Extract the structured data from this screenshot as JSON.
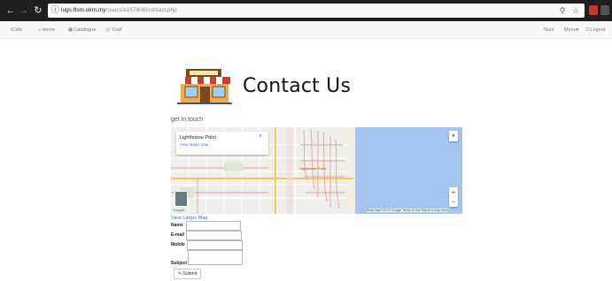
{
  "browser": {
    "url_domain": "lugs.ftsm.ukm.my",
    "url_path": "/users/a157408/contact.php",
    "info_icon": "info-icon",
    "back_icon": "back-arrow-icon",
    "forward_icon": "forward-arrow-icon",
    "reload_icon": "reload-icon"
  },
  "navbar": {
    "brand": "iCafe",
    "items": [
      {
        "label": "Home",
        "icon": "home-icon"
      },
      {
        "label": "Catalogue",
        "icon": "grid-icon"
      },
      {
        "label": "Cart",
        "icon": "cart-icon"
      }
    ],
    "right": [
      {
        "label": "Nuoi"
      },
      {
        "label": "Menu▾"
      },
      {
        "label": "Logout",
        "icon": "logout-icon"
      }
    ]
  },
  "page": {
    "title": "Contact Us",
    "hero_icon": "store-icon",
    "subtitle": "get in touch"
  },
  "map": {
    "place_name": "Lighthouse Point",
    "view_larger": "View larger map",
    "place_label": "Lighthouse Point",
    "zoom_in": "+",
    "zoom_out": "−",
    "google": "Google",
    "attribution": "Map data ©2015 Google   Terms of Use   Report a map error"
  },
  "form": {
    "view_larger_link": "View Larger Map",
    "fields": [
      {
        "label": "Name",
        "value": ""
      },
      {
        "label": "E-mail",
        "value": ""
      },
      {
        "label": "Mobile",
        "value": ""
      },
      {
        "label": "Subject",
        "value": ""
      }
    ],
    "submit": "Submit"
  },
  "colors": {
    "link": "#337ab7",
    "chrome": "#1f1f1f",
    "navbar_bg": "#f8f8f8",
    "water": "#a2c6f0",
    "route": "#e8a0a0"
  }
}
